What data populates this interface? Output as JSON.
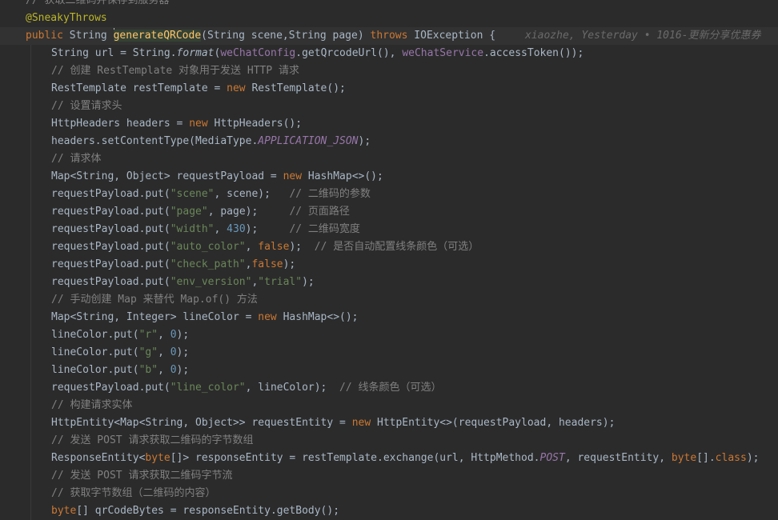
{
  "editor": {
    "blame": "xiaozhe, Yesterday • 1016-更新分享优惠券",
    "lines": [
      [
        [
          "cmt",
          "// 获取二维码并保存到服务器"
        ]
      ],
      [
        [
          "ann",
          "@SneakyThrows"
        ]
      ],
      [
        [
          "kw",
          "public "
        ],
        [
          "plain",
          "String "
        ],
        [
          "caret",
          ""
        ],
        [
          "fnhl",
          "generateQRCode"
        ],
        [
          "plain",
          "(String scene,String page) "
        ],
        [
          "kw",
          "throws "
        ],
        [
          "plain",
          "IOException {"
        ]
      ],
      [
        [
          "plain",
          "String url = String."
        ],
        [
          "ital",
          "format"
        ],
        [
          "plain",
          "("
        ],
        [
          "fld",
          "weChatConfig"
        ],
        [
          "plain",
          ".getQrcodeUrl(), "
        ],
        [
          "fld",
          "weChatService"
        ],
        [
          "plain",
          ".accessToken());"
        ]
      ],
      [
        [
          "cmt",
          "// 创建 RestTemplate 对象用于发送 HTTP 请求"
        ]
      ],
      [
        [
          "plain",
          "RestTemplate restTemplate = "
        ],
        [
          "kw",
          "new "
        ],
        [
          "plain",
          "RestTemplate();"
        ]
      ],
      [
        [
          "cmt",
          "// 设置请求头"
        ]
      ],
      [
        [
          "plain",
          "HttpHeaders headers = "
        ],
        [
          "kw",
          "new "
        ],
        [
          "plain",
          "HttpHeaders();"
        ]
      ],
      [
        [
          "plain",
          "headers.setContentType(MediaType."
        ],
        [
          "fldi",
          "APPLICATION_JSON"
        ],
        [
          "plain",
          ");"
        ]
      ],
      [
        [
          "cmt",
          "// 请求体"
        ]
      ],
      [
        [
          "plain",
          "Map<String, Object> requestPayload = "
        ],
        [
          "kw",
          "new "
        ],
        [
          "plain",
          "HashMap<>();"
        ]
      ],
      [
        [
          "plain",
          "requestPayload.put("
        ],
        [
          "str",
          "\"scene\""
        ],
        [
          "plain",
          ", scene);   "
        ],
        [
          "cmt",
          "// 二维码的参数"
        ]
      ],
      [
        [
          "plain",
          "requestPayload.put("
        ],
        [
          "str",
          "\"page\""
        ],
        [
          "plain",
          ", page);     "
        ],
        [
          "cmt",
          "// 页面路径"
        ]
      ],
      [
        [
          "plain",
          "requestPayload.put("
        ],
        [
          "str",
          "\"width\""
        ],
        [
          "plain",
          ", "
        ],
        [
          "num",
          "430"
        ],
        [
          "plain",
          ");     "
        ],
        [
          "cmt",
          "// 二维码宽度"
        ]
      ],
      [
        [
          "plain",
          "requestPayload.put("
        ],
        [
          "str",
          "\"auto_color\""
        ],
        [
          "plain",
          ", "
        ],
        [
          "kw",
          "false"
        ],
        [
          "plain",
          ");  "
        ],
        [
          "cmt",
          "// 是否自动配置线条颜色（可选）"
        ]
      ],
      [
        [
          "plain",
          "requestPayload.put("
        ],
        [
          "str",
          "\"check_path\""
        ],
        [
          "plain",
          ","
        ],
        [
          "kw",
          "false"
        ],
        [
          "plain",
          ");"
        ]
      ],
      [
        [
          "plain",
          "requestPayload.put("
        ],
        [
          "str",
          "\"env_version\""
        ],
        [
          "plain",
          ","
        ],
        [
          "str",
          "\"trial\""
        ],
        [
          "plain",
          ");"
        ]
      ],
      [
        [
          "cmt",
          "// 手动创建 Map 来替代 Map.of() 方法"
        ]
      ],
      [
        [
          "plain",
          "Map<String, Integer> lineColor = "
        ],
        [
          "kw",
          "new "
        ],
        [
          "plain",
          "HashMap<>();"
        ]
      ],
      [
        [
          "plain",
          "lineColor.put("
        ],
        [
          "str",
          "\"r\""
        ],
        [
          "plain",
          ", "
        ],
        [
          "num",
          "0"
        ],
        [
          "plain",
          ");"
        ]
      ],
      [
        [
          "plain",
          "lineColor.put("
        ],
        [
          "str",
          "\"g\""
        ],
        [
          "plain",
          ", "
        ],
        [
          "num",
          "0"
        ],
        [
          "plain",
          ");"
        ]
      ],
      [
        [
          "plain",
          "lineColor.put("
        ],
        [
          "str",
          "\"b\""
        ],
        [
          "plain",
          ", "
        ],
        [
          "num",
          "0"
        ],
        [
          "plain",
          ");"
        ]
      ],
      [
        [
          "plain",
          "requestPayload.put("
        ],
        [
          "str",
          "\"line_color\""
        ],
        [
          "plain",
          ", lineColor);  "
        ],
        [
          "cmt",
          "// 线条颜色（可选）"
        ]
      ],
      [
        [
          "cmt",
          "// 构建请求实体"
        ]
      ],
      [
        [
          "plain",
          "HttpEntity<Map<String, Object>> requestEntity = "
        ],
        [
          "kw",
          "new "
        ],
        [
          "plain",
          "HttpEntity<>(requestPayload, headers);"
        ]
      ],
      [
        [
          "cmt",
          "// 发送 POST 请求获取二维码的字节数组"
        ]
      ],
      [
        [
          "plain",
          "ResponseEntity<"
        ],
        [
          "kw",
          "byte"
        ],
        [
          "plain",
          "[]> responseEntity = restTemplate.exchange(url, HttpMethod."
        ],
        [
          "fldi",
          "POST"
        ],
        [
          "plain",
          ", requestEntity, "
        ],
        [
          "kw",
          "byte"
        ],
        [
          "plain",
          "[]."
        ],
        [
          "kw",
          "class"
        ],
        [
          "plain",
          ");"
        ]
      ],
      [
        [
          "cmt",
          "// 发送 POST 请求获取二维码字节流"
        ]
      ],
      [
        [
          "cmt",
          "// 获取字节数组（二维码的内容）"
        ]
      ],
      [
        [
          "kw",
          "byte"
        ],
        [
          "plain",
          "[] qrCodeBytes = responseEntity.getBody();"
        ]
      ]
    ]
  }
}
